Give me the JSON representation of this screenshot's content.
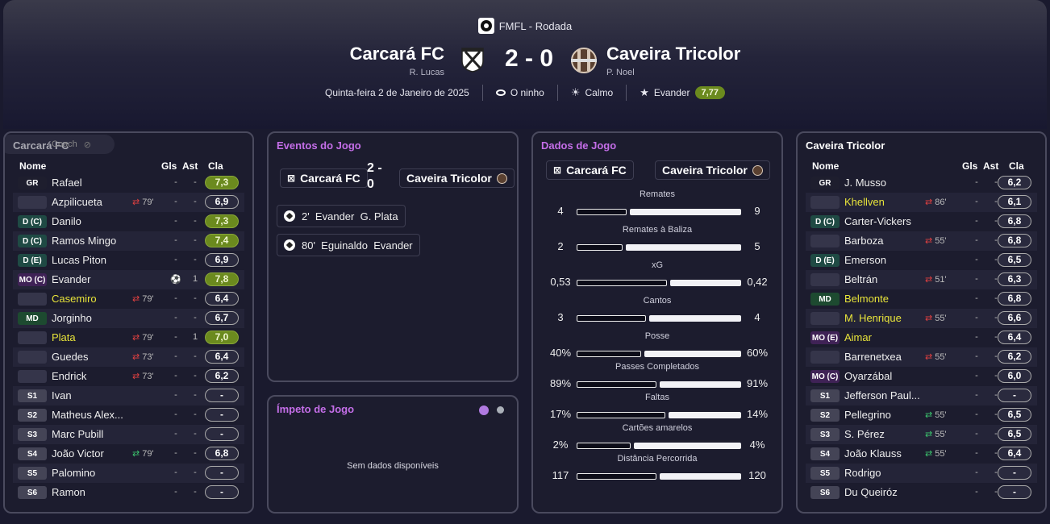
{
  "header": {
    "competition": "FMFL - Rodada",
    "home_team": "Carcará FC",
    "home_coach": "R. Lucas",
    "away_team": "Caveira Tricolor",
    "away_coach": "P. Noel",
    "score": "2 - 0",
    "date": "Quinta-feira 2 de Janeiro de 2025",
    "stadium": "O ninho",
    "weather": "Calmo",
    "mom_name": "Evander",
    "mom_rating": "7,77"
  },
  "colors": {
    "accent_purple": "#c46ee8",
    "rating_green": "#6b8a1e",
    "yellow_name": "#e8e43a"
  },
  "home_panel": {
    "title": "Carcará FC",
    "overlay": "Coach",
    "cols": {
      "name": "Nome",
      "goals": "Gls",
      "assists": "Ast",
      "rating": "Cla"
    },
    "players": [
      {
        "pos": "GR",
        "posclass": "gk",
        "name": "Rafael",
        "sub": "",
        "subdir": "",
        "gls": "-",
        "ast": "-",
        "rating": "7,3",
        "good": true,
        "yellow": false
      },
      {
        "pos": "",
        "posclass": "blank",
        "name": "Azpilicueta",
        "sub": "79'",
        "subdir": "out",
        "gls": "-",
        "ast": "-",
        "rating": "6,9",
        "good": false,
        "yellow": false
      },
      {
        "pos": "D (C)",
        "posclass": "def",
        "name": "Danilo",
        "sub": "",
        "subdir": "",
        "gls": "-",
        "ast": "-",
        "rating": "7,3",
        "good": true,
        "yellow": false
      },
      {
        "pos": "D (C)",
        "posclass": "def",
        "name": "Ramos Mingo",
        "sub": "",
        "subdir": "",
        "gls": "-",
        "ast": "-",
        "rating": "7,4",
        "good": true,
        "yellow": false
      },
      {
        "pos": "D (E)",
        "posclass": "def",
        "name": "Lucas Piton",
        "sub": "",
        "subdir": "",
        "gls": "-",
        "ast": "-",
        "rating": "6,9",
        "good": false,
        "yellow": false
      },
      {
        "pos": "MO (C)",
        "posclass": "att",
        "name": "Evander",
        "sub": "",
        "subdir": "",
        "gls": "goal",
        "ast": "1",
        "rating": "7,8",
        "good": true,
        "yellow": false
      },
      {
        "pos": "",
        "posclass": "blank",
        "name": "Casemiro",
        "sub": "79'",
        "subdir": "out",
        "gls": "-",
        "ast": "-",
        "rating": "6,4",
        "good": false,
        "yellow": true
      },
      {
        "pos": "MD",
        "posclass": "mid",
        "name": "Jorginho",
        "sub": "",
        "subdir": "",
        "gls": "-",
        "ast": "-",
        "rating": "6,7",
        "good": false,
        "yellow": false
      },
      {
        "pos": "",
        "posclass": "blank",
        "name": "Plata",
        "sub": "79'",
        "subdir": "out",
        "gls": "-",
        "ast": "1",
        "rating": "7,0",
        "good": true,
        "yellow": true
      },
      {
        "pos": "",
        "posclass": "blank",
        "name": "Guedes",
        "sub": "73'",
        "subdir": "out",
        "gls": "-",
        "ast": "-",
        "rating": "6,4",
        "good": false,
        "yellow": false
      },
      {
        "pos": "",
        "posclass": "blank",
        "name": "Endrick",
        "sub": "73'",
        "subdir": "out",
        "gls": "-",
        "ast": "-",
        "rating": "6,2",
        "good": false,
        "yellow": false
      },
      {
        "pos": "S1",
        "posclass": "sub",
        "name": "Ivan",
        "sub": "",
        "subdir": "",
        "gls": "-",
        "ast": "-",
        "rating": "-",
        "good": false,
        "yellow": false
      },
      {
        "pos": "S2",
        "posclass": "sub",
        "name": "Matheus Alex...",
        "sub": "",
        "subdir": "",
        "gls": "-",
        "ast": "-",
        "rating": "-",
        "good": false,
        "yellow": false
      },
      {
        "pos": "S3",
        "posclass": "sub",
        "name": "Marc Pubill",
        "sub": "",
        "subdir": "",
        "gls": "-",
        "ast": "-",
        "rating": "-",
        "good": false,
        "yellow": false
      },
      {
        "pos": "S4",
        "posclass": "sub",
        "name": "João Victor",
        "sub": "79'",
        "subdir": "in",
        "gls": "-",
        "ast": "-",
        "rating": "6,8",
        "good": false,
        "yellow": false
      },
      {
        "pos": "S5",
        "posclass": "sub",
        "name": "Palomino",
        "sub": "",
        "subdir": "",
        "gls": "-",
        "ast": "-",
        "rating": "-",
        "good": false,
        "yellow": false
      },
      {
        "pos": "S6",
        "posclass": "sub",
        "name": "Ramon",
        "sub": "",
        "subdir": "",
        "gls": "-",
        "ast": "-",
        "rating": "-",
        "good": false,
        "yellow": false
      }
    ]
  },
  "away_panel": {
    "title": "Caveira Tricolor",
    "cols": {
      "name": "Nome",
      "goals": "Gls",
      "assists": "Ast",
      "rating": "Cla"
    },
    "players": [
      {
        "pos": "GR",
        "posclass": "gk",
        "name": "J. Musso",
        "sub": "",
        "subdir": "",
        "gls": "-",
        "ast": "-",
        "rating": "6,2",
        "good": false,
        "yellow": false
      },
      {
        "pos": "",
        "posclass": "blank",
        "name": "Khellven",
        "sub": "86'",
        "subdir": "out",
        "gls": "-",
        "ast": "-",
        "rating": "6,1",
        "good": false,
        "yellow": true
      },
      {
        "pos": "D (C)",
        "posclass": "def",
        "name": "Carter-Vickers",
        "sub": "",
        "subdir": "",
        "gls": "-",
        "ast": "-",
        "rating": "6,8",
        "good": false,
        "yellow": false
      },
      {
        "pos": "",
        "posclass": "blank",
        "name": "Barboza",
        "sub": "55'",
        "subdir": "out",
        "gls": "-",
        "ast": "-",
        "rating": "6,8",
        "good": false,
        "yellow": false
      },
      {
        "pos": "D (E)",
        "posclass": "def",
        "name": "Emerson",
        "sub": "",
        "subdir": "",
        "gls": "-",
        "ast": "-",
        "rating": "6,5",
        "good": false,
        "yellow": false
      },
      {
        "pos": "",
        "posclass": "blank",
        "name": "Beltrán",
        "sub": "51'",
        "subdir": "out",
        "gls": "-",
        "ast": "-",
        "rating": "6,3",
        "good": false,
        "yellow": false
      },
      {
        "pos": "MD",
        "posclass": "mid",
        "name": "Belmonte",
        "sub": "",
        "subdir": "",
        "gls": "-",
        "ast": "-",
        "rating": "6,8",
        "good": false,
        "yellow": true
      },
      {
        "pos": "",
        "posclass": "blank",
        "name": "M. Henrique",
        "sub": "55'",
        "subdir": "out",
        "gls": "-",
        "ast": "-",
        "rating": "6,6",
        "good": false,
        "yellow": true
      },
      {
        "pos": "MO (E)",
        "posclass": "att",
        "name": "Aimar",
        "sub": "",
        "subdir": "",
        "gls": "-",
        "ast": "-",
        "rating": "6,4",
        "good": false,
        "yellow": true
      },
      {
        "pos": "",
        "posclass": "blank",
        "name": "Barrenetxea",
        "sub": "55'",
        "subdir": "out",
        "gls": "-",
        "ast": "-",
        "rating": "6,2",
        "good": false,
        "yellow": false
      },
      {
        "pos": "MO (C)",
        "posclass": "att",
        "name": "Oyarzábal",
        "sub": "",
        "subdir": "",
        "gls": "-",
        "ast": "-",
        "rating": "6,0",
        "good": false,
        "yellow": false
      },
      {
        "pos": "S1",
        "posclass": "sub",
        "name": "Jefferson Paul...",
        "sub": "",
        "subdir": "",
        "gls": "-",
        "ast": "-",
        "rating": "-",
        "good": false,
        "yellow": false
      },
      {
        "pos": "S2",
        "posclass": "sub",
        "name": "Pellegrino",
        "sub": "55'",
        "subdir": "in",
        "gls": "-",
        "ast": "-",
        "rating": "6,5",
        "good": false,
        "yellow": false
      },
      {
        "pos": "S3",
        "posclass": "sub",
        "name": "S. Pérez",
        "sub": "55'",
        "subdir": "in",
        "gls": "-",
        "ast": "-",
        "rating": "6,5",
        "good": false,
        "yellow": false
      },
      {
        "pos": "S4",
        "posclass": "sub",
        "name": "João Klauss",
        "sub": "55'",
        "subdir": "in",
        "gls": "-",
        "ast": "-",
        "rating": "6,4",
        "good": false,
        "yellow": false
      },
      {
        "pos": "S5",
        "posclass": "sub",
        "name": "Rodrigo",
        "sub": "",
        "subdir": "",
        "gls": "-",
        "ast": "-",
        "rating": "-",
        "good": false,
        "yellow": false
      },
      {
        "pos": "S6",
        "posclass": "sub",
        "name": "Du Queiróz",
        "sub": "",
        "subdir": "",
        "gls": "-",
        "ast": "-",
        "rating": "-",
        "good": false,
        "yellow": false
      }
    ]
  },
  "events_panel": {
    "title": "Eventos do Jogo",
    "home_team": "Carcará FC",
    "score": "2 -\n0",
    "away_team": "Caveira Tricolor",
    "events": [
      {
        "text": "2'  Evander  G. Plata"
      },
      {
        "text": "80'  Eguinaldo  Evander"
      }
    ]
  },
  "momentum_panel": {
    "title": "Ímpeto de Jogo",
    "empty": "Sem dados disponíveis"
  },
  "stats_panel": {
    "title": "Dados de Jogo",
    "home_team": "Carcará FC",
    "away_team": "Caveira Tricolor",
    "stats": [
      {
        "label": "Remates",
        "home": "4",
        "away": "9",
        "hv": 4,
        "av": 9
      },
      {
        "label": "Remates à Baliza",
        "home": "2",
        "away": "5",
        "hv": 2,
        "av": 5
      },
      {
        "label": "xG",
        "home": "0,53",
        "away": "0,42",
        "hv": 0.53,
        "av": 0.42
      },
      {
        "label": "Cantos",
        "home": "3",
        "away": "4",
        "hv": 3,
        "av": 4
      },
      {
        "label": "Posse",
        "home": "40%",
        "away": "60%",
        "hv": 40,
        "av": 60
      },
      {
        "label": "Passes Completados",
        "home": "89%",
        "away": "91%",
        "hv": 89,
        "av": 91
      },
      {
        "label": "Faltas",
        "home": "17%",
        "away": "14%",
        "hv": 17,
        "av": 14
      },
      {
        "label": "Cartões amarelos",
        "home": "2%",
        "away": "4%",
        "hv": 2,
        "av": 4
      },
      {
        "label": "Distância Percorrida",
        "home": "117",
        "away": "120",
        "hv": 117,
        "av": 120
      }
    ]
  }
}
